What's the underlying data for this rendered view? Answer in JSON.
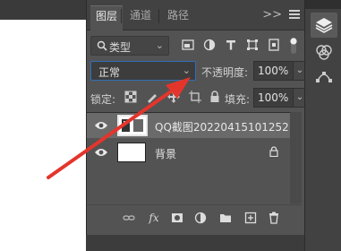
{
  "tabs": [
    {
      "label": "图层",
      "active": true
    },
    {
      "label": "通道",
      "active": false
    },
    {
      "label": "路径",
      "active": false
    }
  ],
  "collapse_glyph": ">>",
  "filter": {
    "kind_label": "类型",
    "icons": [
      "pixel-filter-icon",
      "adjustment-filter-icon",
      "type-filter-icon",
      "shape-filter-icon",
      "smart-object-filter-icon",
      "filter-toggle-switch"
    ]
  },
  "blend": {
    "mode": "正常",
    "opacity_label": "不透明度:",
    "opacity_value": "100%"
  },
  "lock": {
    "label": "锁定:",
    "icons": [
      "lock-transparent-icon",
      "lock-image-icon",
      "lock-position-icon",
      "lock-artboard-icon",
      "lock-all-icon"
    ],
    "fill_label": "填充:",
    "fill_value": "100%"
  },
  "layers": [
    {
      "name": "QQ截图20220415101252",
      "selected": true,
      "locked": false
    },
    {
      "name": "背景",
      "selected": false,
      "locked": true
    }
  ],
  "bottom_icons": [
    "link-layers-icon",
    "fx-icon",
    "mask-icon",
    "adjustment-icon",
    "group-folder-icon",
    "new-layer-icon",
    "delete-icon"
  ],
  "fx_label": "fx",
  "dock_icons": [
    "layers-panel-icon",
    "channels-panel-icon",
    "paths-panel-icon"
  ],
  "colors": {
    "panel_bg": "#535353",
    "selected_row": "#6a6a6a",
    "arrow": "#e4352c",
    "focus_border": "#2f6fb8"
  }
}
